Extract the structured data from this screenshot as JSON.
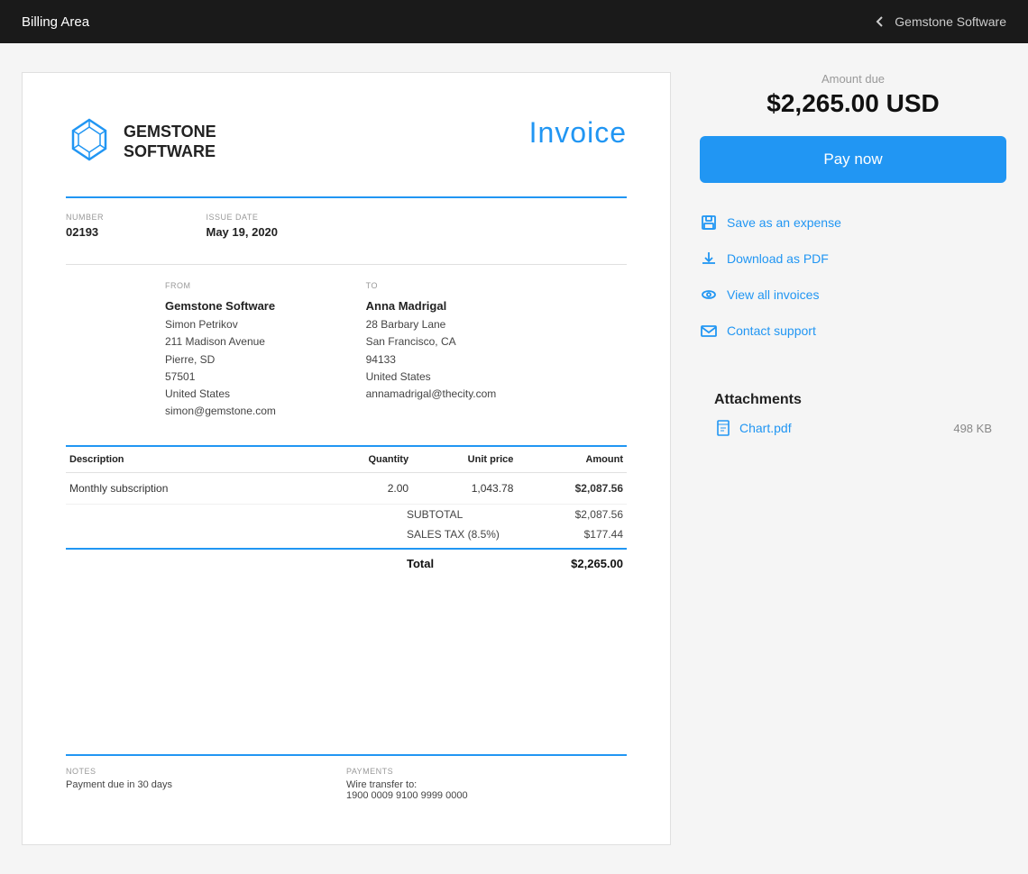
{
  "topnav": {
    "title": "Billing Area",
    "back_icon": "arrow-left-icon",
    "company": "Gemstone Software"
  },
  "invoice": {
    "logo_text_line1": "GEMSTONE",
    "logo_text_line2": "SOFTWARE",
    "title": "Invoice",
    "number_label": "NUMBER",
    "number_value": "02193",
    "issue_date_label": "ISSUE DATE",
    "issue_date_value": "May 19, 2020",
    "from_label": "FROM",
    "from_name": "Gemstone Software",
    "from_contact": "Simon Petrikov",
    "from_address1": "211 Madison Avenue",
    "from_address2": "Pierre, SD",
    "from_zip": "57501",
    "from_country": "United States",
    "from_email": "simon@gemstone.com",
    "to_label": "TO",
    "to_name": "Anna Madrigal",
    "to_address1": "28 Barbary Lane",
    "to_address2": "San Francisco, CA",
    "to_zip": "94133",
    "to_country": "United States",
    "to_email": "annamadrigal@thecity.com",
    "table": {
      "headers": [
        "Description",
        "Quantity",
        "Unit price",
        "Amount"
      ],
      "rows": [
        {
          "description": "Monthly subscription",
          "quantity": "2.00",
          "unit_price": "1,043.78",
          "amount": "$2,087.56"
        }
      ],
      "subtotal_label": "SUBTOTAL",
      "subtotal_value": "$2,087.56",
      "tax_label": "SALES TAX (8.5%)",
      "tax_value": "$177.44",
      "total_label": "Total",
      "total_value": "$2,265.00"
    },
    "notes_label": "NOTES",
    "notes_value": "Payment due in 30 days",
    "payments_label": "PAYMENTS",
    "payments_line1": "Wire transfer to:",
    "payments_line2": "1900 0009 9100 9999 0000"
  },
  "sidebar": {
    "amount_due_label": "Amount due",
    "amount_due_value": "$2,265.00 USD",
    "pay_now_label": "Pay now",
    "actions": [
      {
        "id": "save-expense",
        "label": "Save as an expense",
        "icon": "save-icon"
      },
      {
        "id": "download-pdf",
        "label": "Download as PDF",
        "icon": "download-icon"
      },
      {
        "id": "view-invoices",
        "label": "View all invoices",
        "icon": "eye-icon"
      },
      {
        "id": "contact-support",
        "label": "Contact support",
        "icon": "mail-icon"
      }
    ],
    "attachments_title": "Attachments",
    "attachment_name": "Chart.pdf",
    "attachment_size": "498 KB"
  }
}
